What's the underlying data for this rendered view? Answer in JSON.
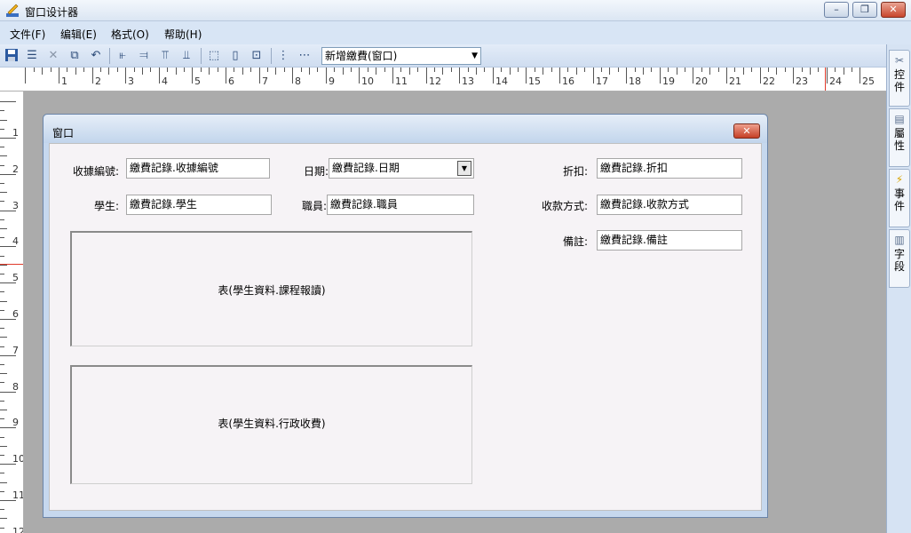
{
  "app": {
    "title": "窗口设计器",
    "controls": {
      "minimize": "–",
      "restore": "❐",
      "close": "✕"
    }
  },
  "menu": [
    "文件(F)",
    "编辑(E)",
    "格式(O)",
    "帮助(H)"
  ],
  "toolbar": {
    "icons": [
      "save-icon",
      "properties-list-icon",
      "delete-icon",
      "copy-icon",
      "undo-icon",
      "align-left-icon",
      "align-right-icon",
      "align-top-icon",
      "align-bottom-icon",
      "same-width-icon",
      "same-height-icon",
      "same-size-icon",
      "space-vertical-icon",
      "space-horizontal-icon"
    ],
    "window_select": "新增繳費(窗口)"
  },
  "ruler": {
    "h_numbers": [
      "1",
      "2",
      "3",
      "4",
      "5",
      "6",
      "7",
      "8",
      "9",
      "10",
      "11",
      "12",
      "13",
      "14",
      "15",
      "16",
      "17",
      "18",
      "19",
      "20",
      "21",
      "22",
      "23",
      "24",
      "25"
    ],
    "v_numbers": [
      "1",
      "2",
      "3",
      "4",
      "5",
      "6",
      "7",
      "8",
      "9",
      "10",
      "11",
      "12"
    ]
  },
  "inner_window": {
    "title": "窗口",
    "close": "✕"
  },
  "form": {
    "receipt_no": {
      "label": "收據編號:",
      "value": "繳費記錄.收據編號"
    },
    "date": {
      "label": "日期:",
      "value": "繳費記錄.日期"
    },
    "discount": {
      "label": "折扣:",
      "value": "繳費記錄.折扣"
    },
    "student": {
      "label": "學生:",
      "value": "繳費記錄.學生"
    },
    "staff": {
      "label": "職員:",
      "value": "繳費記錄.職員"
    },
    "payment_method": {
      "label": "收款方式:",
      "value": "繳費記錄.收款方式"
    },
    "remark": {
      "label": "備註:",
      "value": "繳費記錄.備註"
    },
    "grid1": "表(學生資料.課程報讀)",
    "grid2": "表(學生資料.行政收費)"
  },
  "side_panel": [
    {
      "icon": "tools-icon",
      "label": "控件"
    },
    {
      "icon": "properties-icon",
      "label": "屬性"
    },
    {
      "icon": "lightning-icon",
      "label": "事件"
    },
    {
      "icon": "fields-icon",
      "label": "字段"
    }
  ]
}
